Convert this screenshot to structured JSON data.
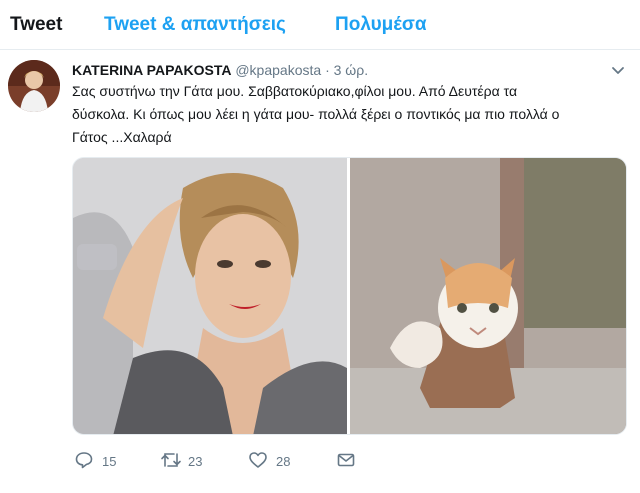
{
  "tabs": [
    {
      "label": "Tweet"
    },
    {
      "label": "Tweet & απαντήσεις"
    },
    {
      "label": "Πολυμέσα"
    }
  ],
  "tweet": {
    "name": "KATERINA PAPAKOSTA",
    "handle": "@kpapakosta",
    "separator": "·",
    "time": "3 ώρ.",
    "text_lines": [
      "Σας συστήνω την Γάτα μου. Σαββατοκύριακο,φίλοι μου. Από Δευτέρα τα",
      "δύσκολα. Κι όπως μου λέει η γάτα μου- πολλά ξέρει ο ποντικός μα πιο πολλά ο",
      "Γάτος ...Χαλαρά"
    ],
    "media": [
      {
        "subject": "woman-portrait"
      },
      {
        "subject": "orange-white-cat-behind-screen"
      }
    ],
    "actions": {
      "reply_count": "15",
      "retweet_count": "23",
      "like_count": "28"
    }
  },
  "icons": [
    "caret-down-icon",
    "reply-icon",
    "retweet-icon",
    "heart-icon",
    "envelope-icon"
  ],
  "colors": {
    "accent": "#1da1f2",
    "text": "#14171a",
    "muted": "#657786",
    "border": "#e6ecf0"
  }
}
